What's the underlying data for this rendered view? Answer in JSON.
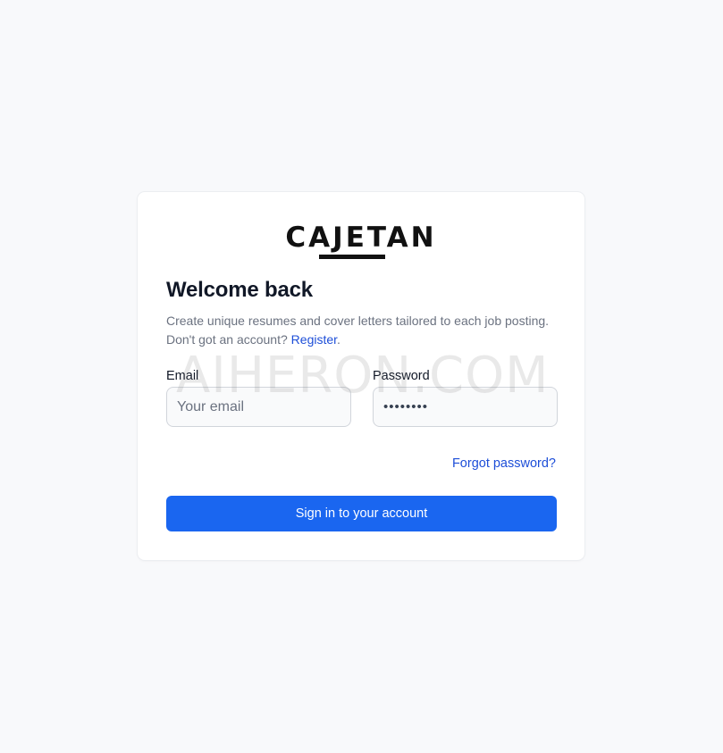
{
  "brand": {
    "logo_text": "CAJETAN"
  },
  "login": {
    "title": "Welcome back",
    "subtitle": "Create unique resumes and cover letters tailored to each job posting.",
    "no_account_text": "Don't got an account?",
    "register_link": "Register",
    "register_suffix": ".",
    "email": {
      "label": "Email",
      "placeholder": "Your email",
      "value": ""
    },
    "password": {
      "label": "Password",
      "value": "••••••••"
    },
    "forgot_link": "Forgot password?",
    "submit_label": "Sign in to your account"
  },
  "watermark": "AIHERON.COM",
  "colors": {
    "accent": "#1a66f0",
    "link": "#1d4ed8",
    "background": "#f8f9fb",
    "card": "#ffffff"
  }
}
